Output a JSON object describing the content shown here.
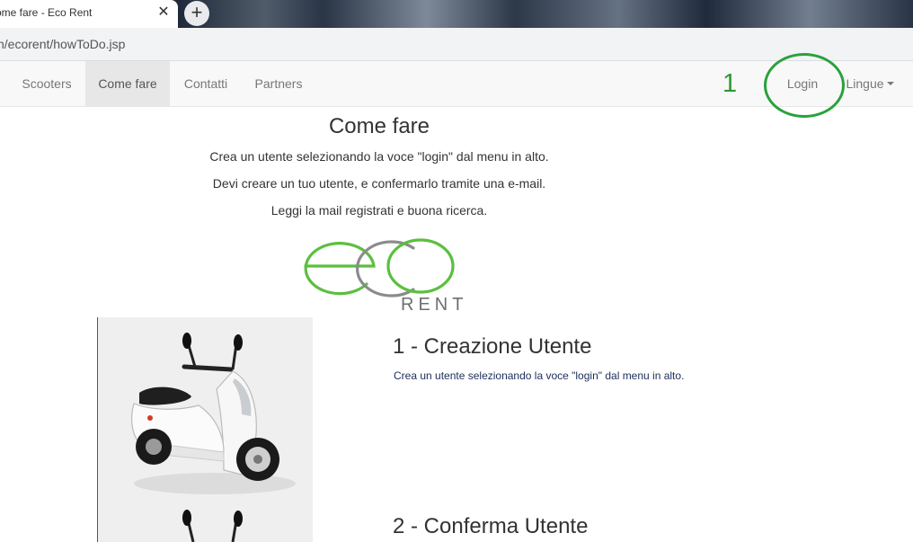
{
  "browser": {
    "tab_title": "ome fare - Eco Rent",
    "tab_close": "✕",
    "new_tab": "+",
    "url": "h/ecorent/howToDo.jsp"
  },
  "navbar": {
    "items": [
      {
        "label": "Scooters"
      },
      {
        "label": "Come fare",
        "active": true
      },
      {
        "label": "Contatti"
      },
      {
        "label": "Partners"
      }
    ],
    "login": "Login",
    "languages": "Lingue"
  },
  "annotation": {
    "number": "1",
    "color": "#2e9a34"
  },
  "main": {
    "title": "Come fare",
    "instructions": [
      "Crea un utente selezionando la voce \"login\" dal menu in alto.",
      "Devi creare un tuo utente, e confermarlo tramite una e-mail.",
      "Leggi la mail registrati e buona ricerca."
    ],
    "logo": {
      "text_main": "eco",
      "text_sub": "RENT",
      "green": "#5bbf3f",
      "gray": "#8a8b8d"
    },
    "steps": [
      {
        "title": "1 - Creazione Utente",
        "description": "Crea un utente selezionando la voce \"login\" dal menu in alto."
      },
      {
        "title": "2 - Conferma Utente"
      }
    ]
  }
}
